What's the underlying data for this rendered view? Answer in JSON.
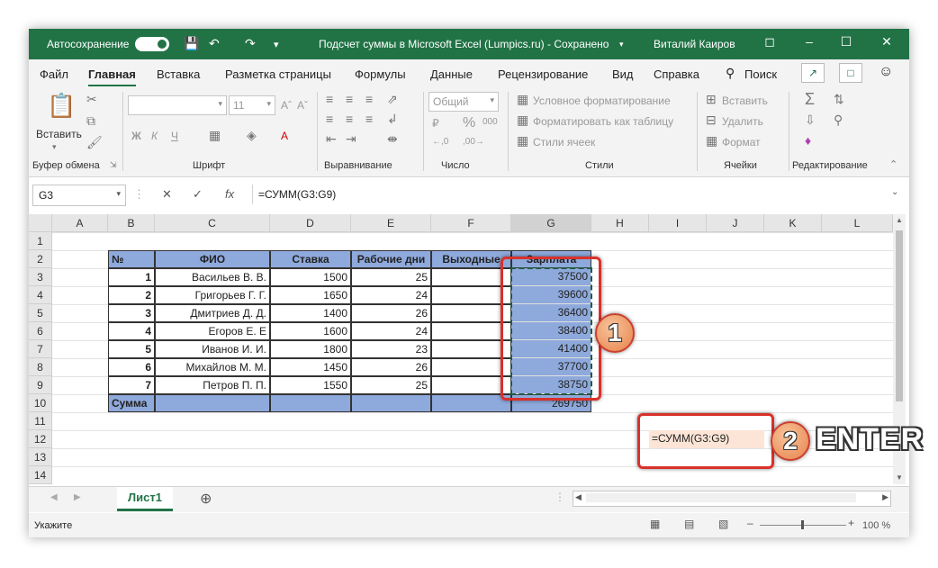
{
  "titlebar": {
    "autosave": "Автосохранение",
    "doc_title": "Подсчет суммы в Microsoft Excel (Lumpics.ru)  -  Сохранено",
    "user": "Виталий Каиров"
  },
  "menu": [
    "Файл",
    "Главная",
    "Вставка",
    "Разметка страницы",
    "Формулы",
    "Данные",
    "Рецензирование",
    "Вид",
    "Справка",
    "Поиск"
  ],
  "ribbon": {
    "paste": "Вставить",
    "font_size": "11",
    "number_format": "Общий",
    "cond_format": "Условное форматирование",
    "format_table": "Форматировать как таблицу",
    "cell_styles": "Стили ячеек",
    "insert": "Вставить",
    "delete": "Удалить",
    "format": "Формат",
    "groups": {
      "clipboard": "Буфер обмена",
      "font": "Шрифт",
      "alignment": "Выравнивание",
      "number": "Число",
      "styles": "Стили",
      "cells": "Ячейки",
      "editing": "Редактирование"
    }
  },
  "formula_bar": {
    "name_box": "G3",
    "formula": "=СУММ(G3:G9)"
  },
  "grid": {
    "columns": [
      "A",
      "B",
      "C",
      "D",
      "E",
      "F",
      "G",
      "H",
      "I",
      "J",
      "K",
      "L"
    ],
    "rows": [
      "1",
      "2",
      "3",
      "4",
      "5",
      "6",
      "7",
      "8",
      "9",
      "10",
      "11",
      "12",
      "13",
      "14"
    ],
    "headers": [
      "№",
      "ФИО",
      "Ставка",
      "Рабочие дни",
      "Выходные",
      "Зарплата"
    ],
    "data": [
      {
        "n": "1",
        "name": "Васильев В. В.",
        "rate": "1500",
        "days": "25",
        "salary": "37500"
      },
      {
        "n": "2",
        "name": "Григорьев Г. Г.",
        "rate": "1650",
        "days": "24",
        "salary": "39600"
      },
      {
        "n": "3",
        "name": "Дмитриев Д. Д.",
        "rate": "1400",
        "days": "26",
        "salary": "36400"
      },
      {
        "n": "4",
        "name": "Егоров Е. Е",
        "rate": "1600",
        "days": "24",
        "salary": "38400"
      },
      {
        "n": "5",
        "name": "Иванов И. И.",
        "rate": "1800",
        "days": "23",
        "salary": "41400"
      },
      {
        "n": "6",
        "name": "Михайлов М. М.",
        "rate": "1450",
        "days": "26",
        "salary": "37700"
      },
      {
        "n": "7",
        "name": "Петров П. П.",
        "rate": "1550",
        "days": "25",
        "salary": "38750"
      }
    ],
    "total_label": "Сумма",
    "total_value": "269750",
    "edit_cell": "=СУММ(G3:G9)"
  },
  "sheet_tab": "Лист1",
  "status": {
    "mode": "Укажите",
    "zoom": "100 %"
  },
  "annotations": {
    "badge1": "1",
    "badge2": "2",
    "enter": "ENTER"
  }
}
